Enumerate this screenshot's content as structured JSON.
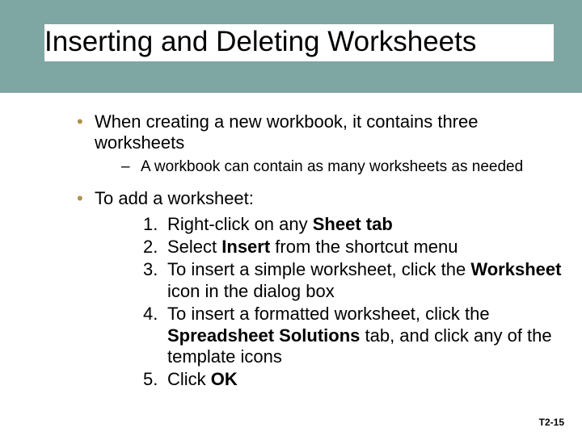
{
  "title": "Inserting and Deleting Worksheets",
  "bullets": {
    "b1": "When creating a new workbook, it contains three worksheets",
    "sub1": "A workbook can contain as many worksheets as needed",
    "b2": "To add a worksheet:",
    "steps": {
      "n1_pre": "Right-click on any ",
      "n1_bold": "Sheet tab",
      "n2_pre": "Select ",
      "n2_bold": "Insert",
      "n2_post": " from the shortcut menu",
      "n3_pre": "To insert a simple worksheet, click the ",
      "n3_bold": "Worksheet",
      "n3_post": " icon in the dialog box",
      "n4_pre": "To insert a formatted worksheet, click the ",
      "n4_bold": "Spreadsheet Solutions",
      "n4_post": " tab, and click any of the template icons",
      "n5_pre": "Click ",
      "n5_bold": "OK"
    }
  },
  "num_labels": {
    "n1": "1.",
    "n2": "2.",
    "n3": "3.",
    "n4": "4.",
    "n5": "5."
  },
  "footer": "T2-15",
  "colors": {
    "band": "#7ea6a3",
    "bullet": "#b0914d"
  }
}
